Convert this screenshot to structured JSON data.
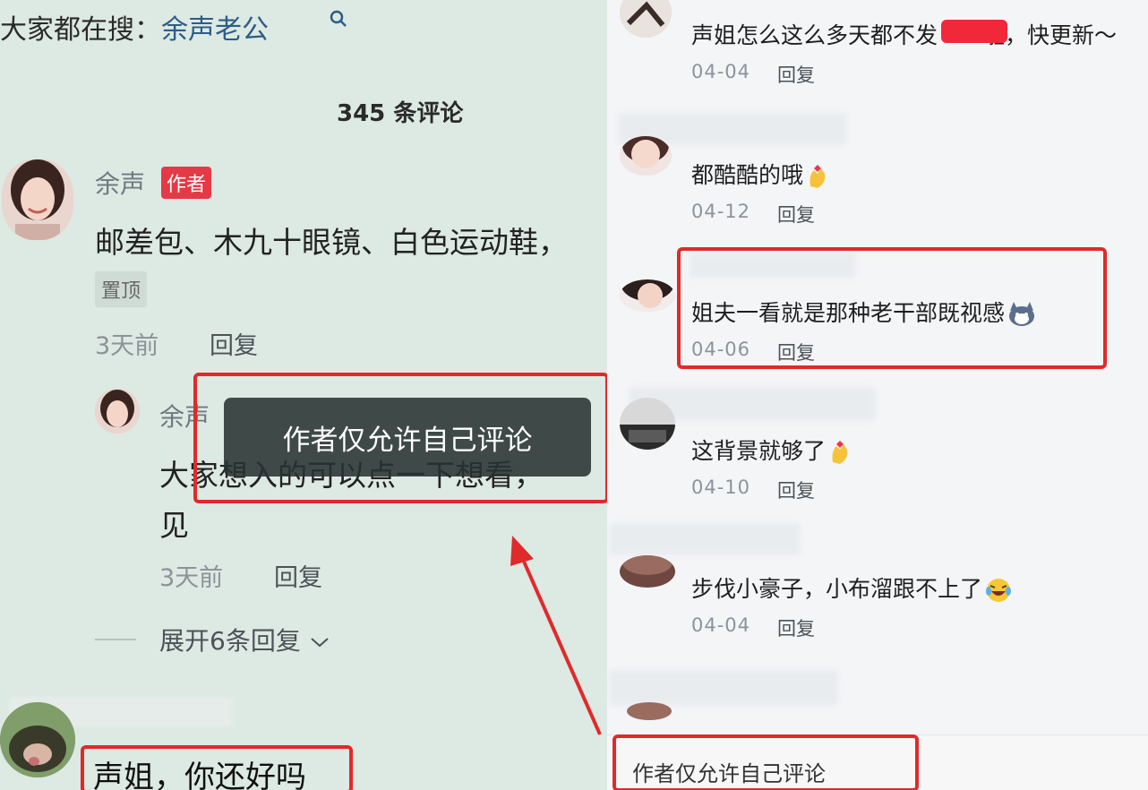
{
  "search": {
    "prefix": "大家都在搜：",
    "keyword": "余声老公"
  },
  "comments_header": {
    "count_label": "345 条评论"
  },
  "pinned_comment": {
    "author": "余声",
    "author_badge": "作者",
    "text": "邮差包、木九十眼镜、白色运动鞋，",
    "pin_tag": "置顶",
    "time": "3天前",
    "reply_label": "回复"
  },
  "sub_comment": {
    "author": "余声",
    "text_line1": "大家想入的可以点一下想看，",
    "text_line2": "见",
    "time": "3天前",
    "reply_label": "回复"
  },
  "toast": {
    "text": "作者仅允许自己评论"
  },
  "expand_replies": {
    "label": "展开6条回复"
  },
  "bottom_comment": {
    "text": "声姐，你还好吗"
  },
  "right_comments": [
    {
      "text": "声姐怎么这么多天都不发　　啦，快更新～",
      "date": "04-04",
      "reply_label": "回复"
    },
    {
      "text": "都酷酷的哦",
      "date": "04-12",
      "reply_label": "回复"
    },
    {
      "text": "姐夫一看就是那种老干部既视感",
      "date": "04-06",
      "reply_label": "回复"
    },
    {
      "text": "这背景就够了",
      "date": "04-10",
      "reply_label": "回复"
    },
    {
      "text": "步伐小豪子，小布溜跟不上了",
      "date": "04-04",
      "reply_label": "回复"
    }
  ],
  "right_footer": {
    "text": "作者仅允许自己评论"
  },
  "colors": {
    "highlight_red": "#e02a2a",
    "badge_red": "#e53946",
    "left_bg": "#dde9e3",
    "right_bg": "#f4f5f7"
  },
  "icons": [
    "search-icon",
    "chevron-down-icon",
    "heart-hands-emoji-icon",
    "dog-emoji-icon",
    "laughing-emoji-icon"
  ]
}
